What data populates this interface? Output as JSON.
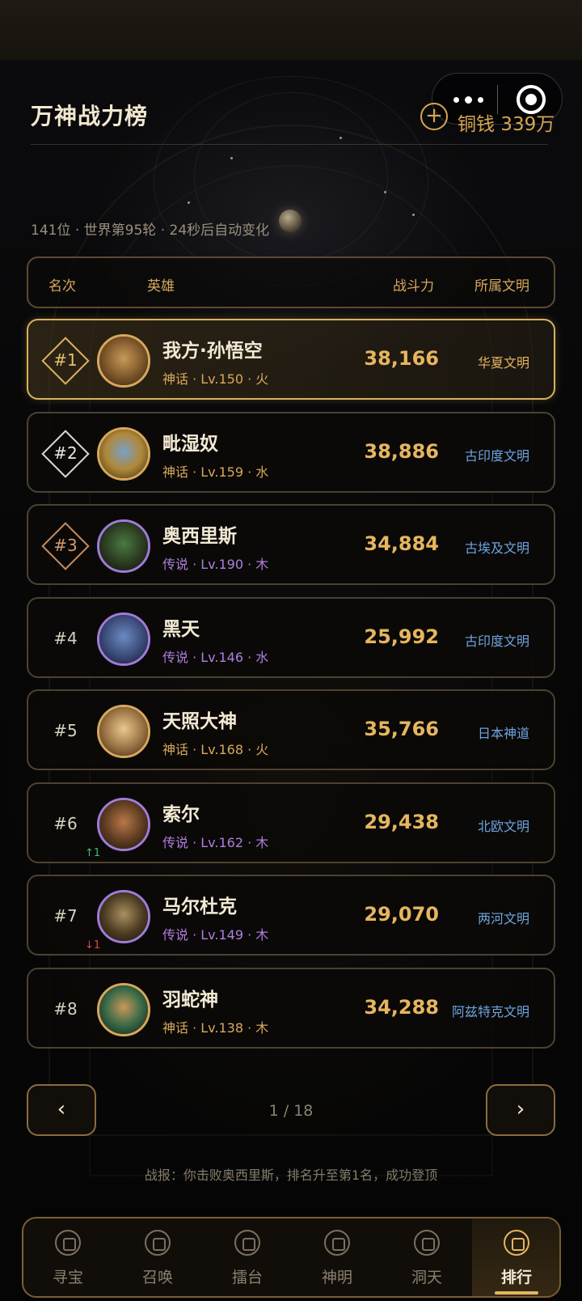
{
  "header": {
    "title": "万神战力榜",
    "currency": "铜钱 339万",
    "info": "141位 · 世界第95轮 · 24秒后自动变化"
  },
  "columns": {
    "rank": "名次",
    "hero": "英雄",
    "power": "战斗力",
    "civ": "所属文明"
  },
  "rows": [
    {
      "rank": "#1",
      "name": "我方·孙悟空",
      "meta": "神话 · Lv.150 · 火",
      "power": "38,166",
      "civ": "华夏文明",
      "delta": ""
    },
    {
      "rank": "#2",
      "name": "毗湿奴",
      "meta": "神话 · Lv.159 · 水",
      "power": "38,886",
      "civ": "古印度文明",
      "delta": ""
    },
    {
      "rank": "#3",
      "name": "奥西里斯",
      "meta": "传说 · Lv.190 · 木",
      "power": "34,884",
      "civ": "古埃及文明",
      "delta": ""
    },
    {
      "rank": "#4",
      "name": "黑天",
      "meta": "传说 · Lv.146 · 水",
      "power": "25,992",
      "civ": "古印度文明",
      "delta": ""
    },
    {
      "rank": "#5",
      "name": "天照大神",
      "meta": "神话 · Lv.168 · 火",
      "power": "35,766",
      "civ": "日本神道",
      "delta": ""
    },
    {
      "rank": "#6",
      "name": "索尔",
      "meta": "传说 · Lv.162 · 木",
      "power": "29,438",
      "civ": "北欧文明",
      "delta": "↑1"
    },
    {
      "rank": "#7",
      "name": "马尔杜克",
      "meta": "传说 · Lv.149 · 木",
      "power": "29,070",
      "civ": "两河文明",
      "delta": "↓1"
    },
    {
      "rank": "#8",
      "name": "羽蛇神",
      "meta": "神话 · Lv.138 · 木",
      "power": "34,288",
      "civ": "阿兹特克文明",
      "delta": ""
    }
  ],
  "pagination": {
    "prev": "‹",
    "next": "›",
    "page": "1 / 18"
  },
  "report": "战报：你击败奥西里斯，排名升至第1名，成功登顶",
  "tabs": [
    {
      "label": "寻宝",
      "icon": "treasure-icon"
    },
    {
      "label": "召唤",
      "icon": "summon-icon"
    },
    {
      "label": "擂台",
      "icon": "arena-icon"
    },
    {
      "label": "神明",
      "icon": "gods-icon"
    },
    {
      "label": "洞天",
      "icon": "cave-icon"
    },
    {
      "label": "排行",
      "icon": "ranking-icon"
    }
  ],
  "colors": {
    "accent_gold": "#e6b55f",
    "civ_blue": "#6ea4e0",
    "legend_purple": "#b07ee0",
    "up_green": "#48b878",
    "down_red": "#d84848"
  }
}
